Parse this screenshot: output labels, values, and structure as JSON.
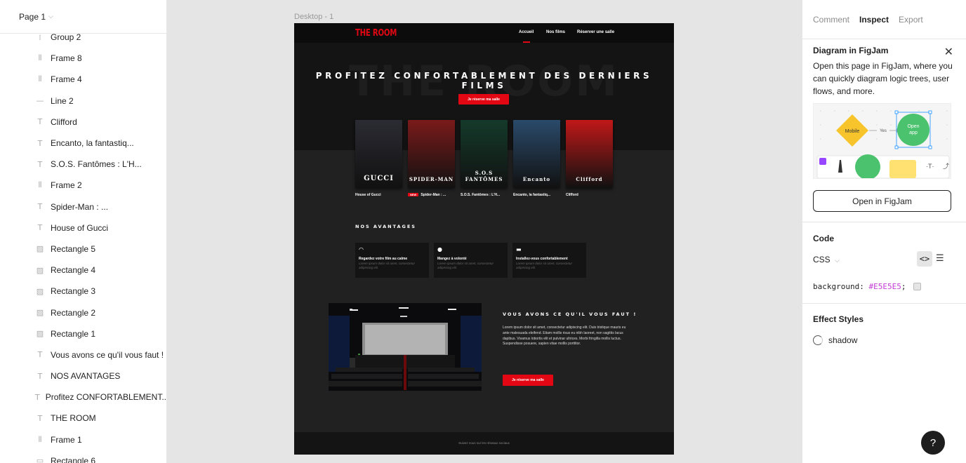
{
  "layers_panel": {
    "page_selector": "Page 1",
    "items": [
      {
        "icon": "group-icon",
        "glyph": "⁞",
        "label": "Group 2"
      },
      {
        "icon": "frame-icon",
        "glyph": "⦀",
        "label": "Frame 8"
      },
      {
        "icon": "frame-icon",
        "glyph": "⦀",
        "label": "Frame 4"
      },
      {
        "icon": "line-icon",
        "glyph": "—",
        "label": "Line 2"
      },
      {
        "icon": "text-icon",
        "glyph": "T",
        "label": "Clifford"
      },
      {
        "icon": "text-icon",
        "glyph": "T",
        "label": "Encanto, la fantastiq..."
      },
      {
        "icon": "text-icon",
        "glyph": "T",
        "label": "S.O.S. Fantômes : L'H..."
      },
      {
        "icon": "frame-icon",
        "glyph": "⦀",
        "label": "Frame 2"
      },
      {
        "icon": "text-icon",
        "glyph": "T",
        "label": "Spider-Man : ..."
      },
      {
        "icon": "text-icon",
        "glyph": "T",
        "label": "House of Gucci"
      },
      {
        "icon": "image-icon",
        "glyph": "▨",
        "label": "Rectangle 5"
      },
      {
        "icon": "image-icon",
        "glyph": "▨",
        "label": "Rectangle 4"
      },
      {
        "icon": "image-icon",
        "glyph": "▨",
        "label": "Rectangle 3"
      },
      {
        "icon": "image-icon",
        "glyph": "▨",
        "label": "Rectangle 2"
      },
      {
        "icon": "image-icon",
        "glyph": "▨",
        "label": "Rectangle 1"
      },
      {
        "icon": "text-icon",
        "glyph": "T",
        "label": "Vous avons ce qu'il vous faut !"
      },
      {
        "icon": "text-icon",
        "glyph": "T",
        "label": "NOS AVANTAGES"
      },
      {
        "icon": "text-icon",
        "glyph": "T",
        "label": "Profitez CONFORTABLEMENT..."
      },
      {
        "icon": "text-icon",
        "glyph": "T",
        "label": "THE ROOM"
      },
      {
        "icon": "frame-icon",
        "glyph": "⦀",
        "label": "Frame 1"
      },
      {
        "icon": "rectangle-icon",
        "glyph": "▭",
        "label": "Rectangle 6"
      }
    ]
  },
  "canvas": {
    "frame_label": "Desktop - 1",
    "site": {
      "brand": "THE ROOM",
      "nav": [
        "Accueil",
        "Nos films",
        "Réserver une salle"
      ],
      "hero_ghost": "THE ROOM",
      "hero_title": "PROFITEZ CONFORTABLEMENT DES DERNIERS FILMS",
      "hero_button": "Je réserve ma salle",
      "new_badge": "NEW",
      "posters": [
        {
          "name": "House of Gucci",
          "art": "GUCCI",
          "color": "#2b2b33"
        },
        {
          "name": "Spider-Man : ...",
          "art": "SPIDER-MAN",
          "color": "#7a1a1a"
        },
        {
          "name": "S.O.S. Fantômes : L'H...",
          "art": "S.O.S FANTÔMES",
          "color": "#143a2a"
        },
        {
          "name": "Encanto, la fantastiq...",
          "art": "Encanto",
          "color": "#2a4a6a"
        },
        {
          "name": "Clifford",
          "art": "Clifford",
          "color": "#c01818"
        }
      ],
      "advantages_title": "NOS AVANTAGES",
      "advantages": [
        {
          "icon": "headphones-icon",
          "glyph": "◠",
          "title": "Regardez votre film au calme",
          "desc": "Lorem ipsum dolor sit amet, consectetur adipiscing elit"
        },
        {
          "icon": "cookie-icon",
          "glyph": "●",
          "title": "Mangez à volonté",
          "desc": "Lorem ipsum dolor sit amet, consectetur adipiscing elit"
        },
        {
          "icon": "sofa-icon",
          "glyph": "▬",
          "title": "Installez-vous confortablement",
          "desc": "Lorem ipsum dolor sit amet, consectetur adipiscing elit"
        }
      ],
      "section_title": "VOUS AVONS CE QU'IL VOUS FAUT !",
      "section_text": "Lorem ipsum dolor sit amet, consectetur adipiscing elit. Duis tristique mauris eu ante malesuada eleifend. Etiam mollis risus eu nibh laoreet, non sagittis lacus dapibus. Vivamus lobortis elit et pulvinar ultrices. Morbi fringilla mollis luctus. Suspendisse posuere, sapien vitae mollis porttitor.",
      "section_button": "Je réserve ma salle",
      "footer": "Suivez nous sur les réseaux sociaux"
    }
  },
  "inspect_panel": {
    "tabs": [
      {
        "label": "Comment",
        "active": false
      },
      {
        "label": "Inspect",
        "active": true
      },
      {
        "label": "Export",
        "active": false
      }
    ],
    "figjam": {
      "title": "Diagram in FigJam",
      "description": "Open this page in FigJam, where you can quickly diagram logic trees, user flows, and more.",
      "preview_mobile": "Mobile",
      "preview_yes": "Yes",
      "preview_open_app": "Open app",
      "preview_text_tool": "·T·",
      "button": "Open in FigJam"
    },
    "code": {
      "title": "Code",
      "language": "CSS",
      "property": "background:",
      "value": "#E5E5E5",
      "suffix": ";"
    },
    "effects": {
      "title": "Effect Styles",
      "items": [
        "shadow"
      ]
    },
    "help": "?"
  },
  "colors": {
    "accent_red": "#e30613",
    "frame_bg": "#212121",
    "canvas_bg": "#e5e5e5",
    "code_value": "#c43bd6"
  }
}
